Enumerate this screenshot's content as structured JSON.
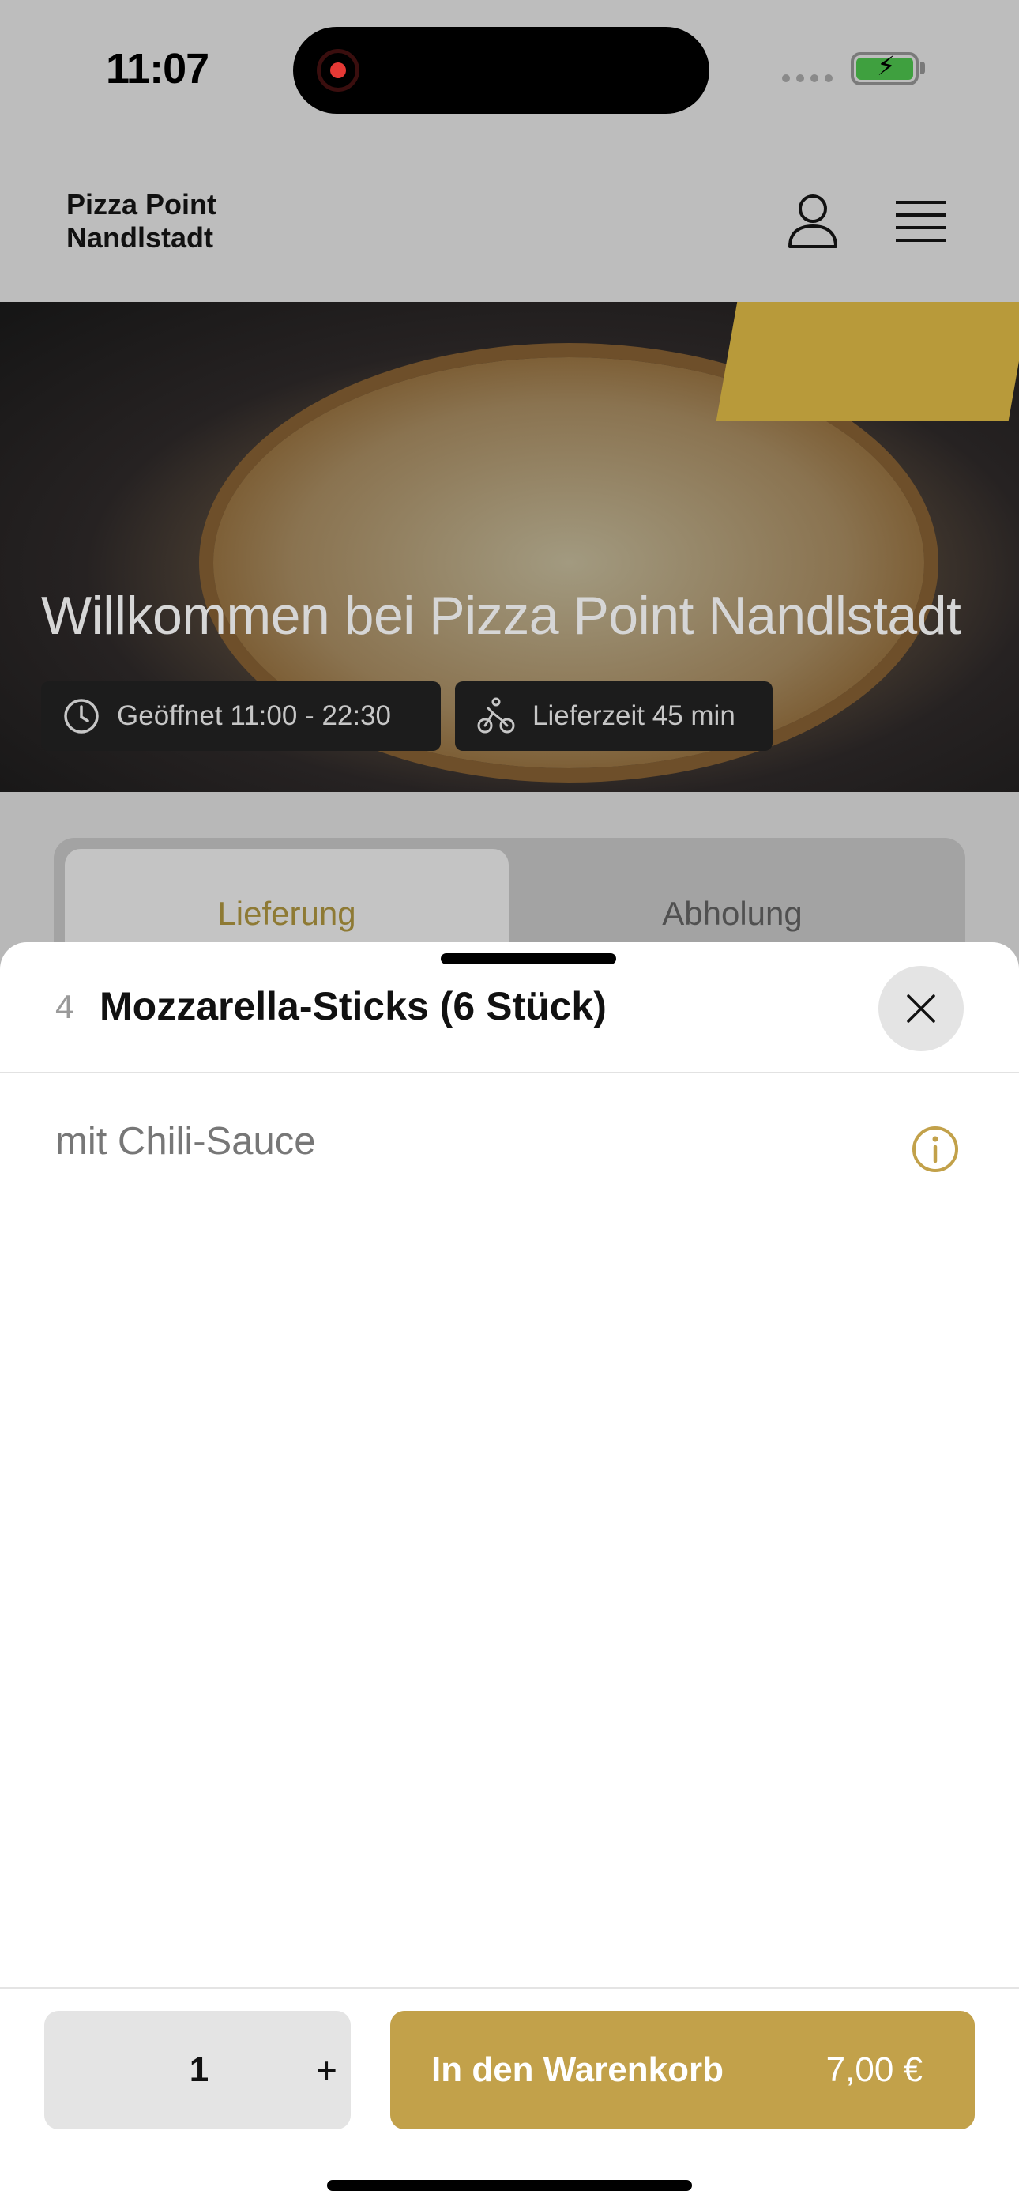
{
  "status_bar": {
    "time": "11:07",
    "recording_icon": "screen-recording-indicator",
    "battery_icon": "battery-charging-icon",
    "battery_color": "#3fa03f"
  },
  "header": {
    "brand": "Pizza Point\nNandlstadt",
    "user_icon": "user-icon",
    "menu_icon": "hamburger-menu-icon"
  },
  "hero": {
    "title": "Willkommen bei Pizza Point Nandlstadt",
    "open_hours": "Geöffnet 11:00 - 22:30",
    "delivery_time": "Lieferzeit 45 min"
  },
  "tabs": {
    "delivery": "Lieferung",
    "pickup": "Abholung",
    "active": "Lieferung",
    "active_color": "#8e7a34"
  },
  "sheet": {
    "item_number": "4",
    "item_title": "Mozzarella-Sticks (6 Stück)",
    "description": "mit Chili-Sauce",
    "close_icon": "close-icon",
    "info_icon": "info-icon",
    "accent_color": "#c2a14a"
  },
  "footer": {
    "quantity": "1",
    "plus": "+",
    "cart_label": "In den Warenkorb",
    "price": "7,00 €"
  }
}
